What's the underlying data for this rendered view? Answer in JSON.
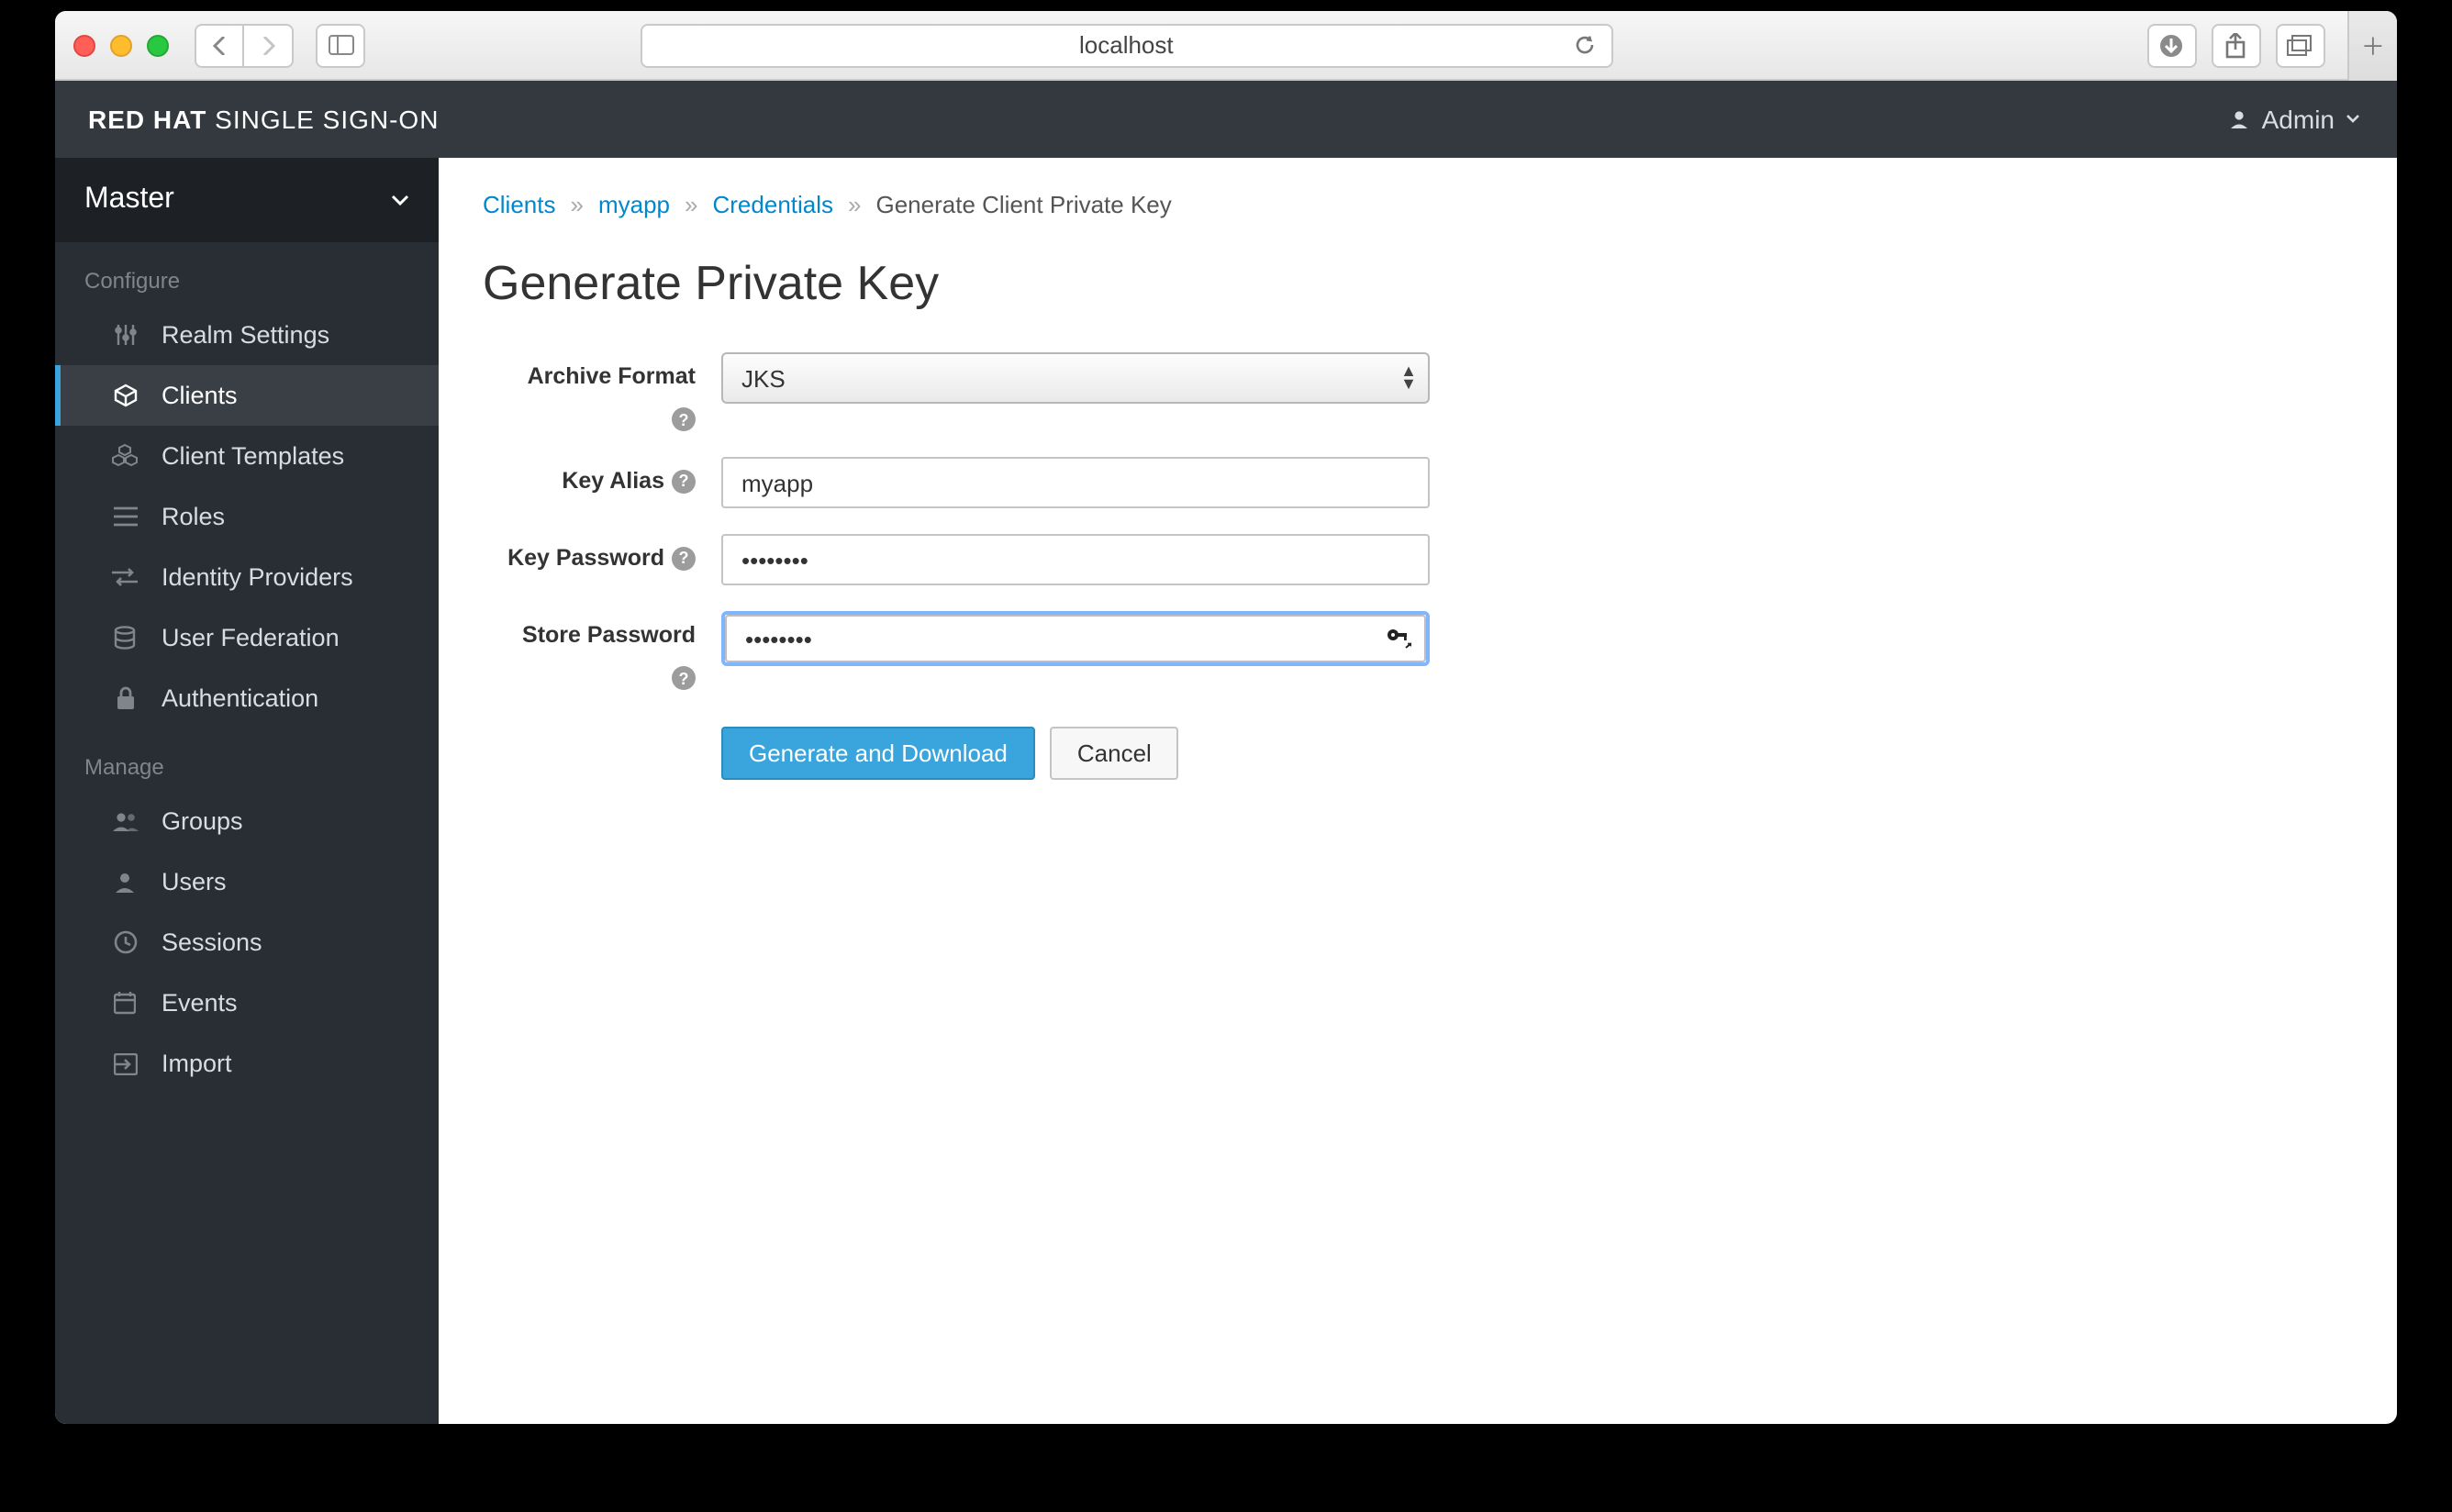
{
  "browser": {
    "address": "localhost"
  },
  "app": {
    "brand_bold": "RED HAT",
    "brand_rest": " SINGLE SIGN-ON",
    "user": "Admin"
  },
  "sidebar": {
    "realm": "Master",
    "sections": [
      {
        "label": "Configure",
        "items": [
          {
            "key": "realm-settings",
            "label": "Realm Settings"
          },
          {
            "key": "clients",
            "label": "Clients",
            "active": true
          },
          {
            "key": "client-templates",
            "label": "Client Templates"
          },
          {
            "key": "roles",
            "label": "Roles"
          },
          {
            "key": "identity-providers",
            "label": "Identity Providers"
          },
          {
            "key": "user-federation",
            "label": "User Federation"
          },
          {
            "key": "authentication",
            "label": "Authentication"
          }
        ]
      },
      {
        "label": "Manage",
        "items": [
          {
            "key": "groups",
            "label": "Groups"
          },
          {
            "key": "users",
            "label": "Users"
          },
          {
            "key": "sessions",
            "label": "Sessions"
          },
          {
            "key": "events",
            "label": "Events"
          },
          {
            "key": "import",
            "label": "Import"
          }
        ]
      }
    ]
  },
  "breadcrumb": {
    "items": [
      "Clients",
      "myapp",
      "Credentials",
      "Generate Client Private Key"
    ]
  },
  "page": {
    "title": "Generate Private Key"
  },
  "form": {
    "archive_format": {
      "label": "Archive Format",
      "value": "JKS"
    },
    "key_alias": {
      "label": "Key Alias",
      "value": "myapp"
    },
    "key_password": {
      "label": "Key Password",
      "value": "••••••••"
    },
    "store_password": {
      "label": "Store Password",
      "value": "••••••••"
    },
    "buttons": {
      "primary": "Generate and Download",
      "cancel": "Cancel"
    }
  }
}
